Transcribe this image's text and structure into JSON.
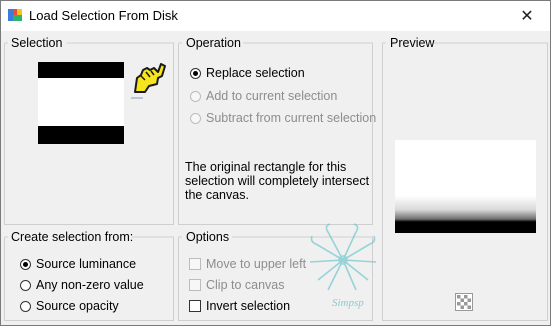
{
  "window": {
    "title": "Load Selection From Disk",
    "close_glyph": "✕"
  },
  "selection": {
    "label": "Selection"
  },
  "operation": {
    "label": "Operation",
    "options": [
      "Replace selection",
      "Add to current selection",
      "Subtract from current selection"
    ],
    "selected": "Replace selection",
    "info": "The original rectangle for this selection will completely intersect the canvas."
  },
  "preview": {
    "label": "Preview"
  },
  "create_from": {
    "label": "Create selection from:",
    "options": [
      "Source luminance",
      "Any non-zero value",
      "Source opacity"
    ],
    "selected": "Source luminance"
  },
  "options": {
    "label": "Options",
    "items": [
      {
        "label": "Move to upper left",
        "checked": false,
        "enabled": false
      },
      {
        "label": "Clip to canvas",
        "checked": false,
        "enabled": false
      },
      {
        "label": "Invert selection",
        "checked": false,
        "enabled": true
      }
    ]
  },
  "watermark": {
    "text": "Simpsp"
  },
  "icons": {
    "app": "psp-app-icon",
    "pointer": "pointing-hand-icon",
    "zoom": "checker-zoom-icon"
  }
}
